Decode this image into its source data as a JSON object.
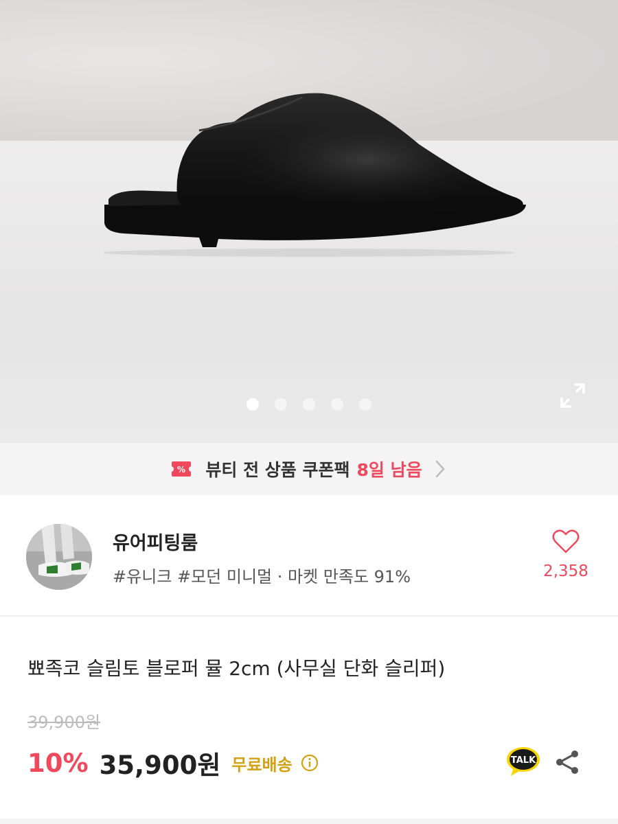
{
  "gallery": {
    "image_alt": "black slip-on mule shoe",
    "page_count": 5,
    "active_index": 0
  },
  "coupon_banner": {
    "text": "뷰티 전 상품 쿠폰팩",
    "days_left": "8일 남음",
    "icon": "coupon-icon",
    "accent_color": "#f0485c"
  },
  "shop": {
    "name": "유어피팅룸",
    "tags": "#유니크 #모던 미니멀 · 마켓 만족도 91%",
    "like_count": "2,358"
  },
  "product": {
    "title": "뾰족코 슬림토 블로퍼 뮬 2cm (사무실 단화 슬리퍼)",
    "original_price": "39,900원",
    "discount": "10%",
    "price": "35,900원",
    "shipping": "무료배송",
    "talk_label": "TALK"
  },
  "colors": {
    "accent": "#f0485c",
    "shipping": "#d4a012"
  }
}
